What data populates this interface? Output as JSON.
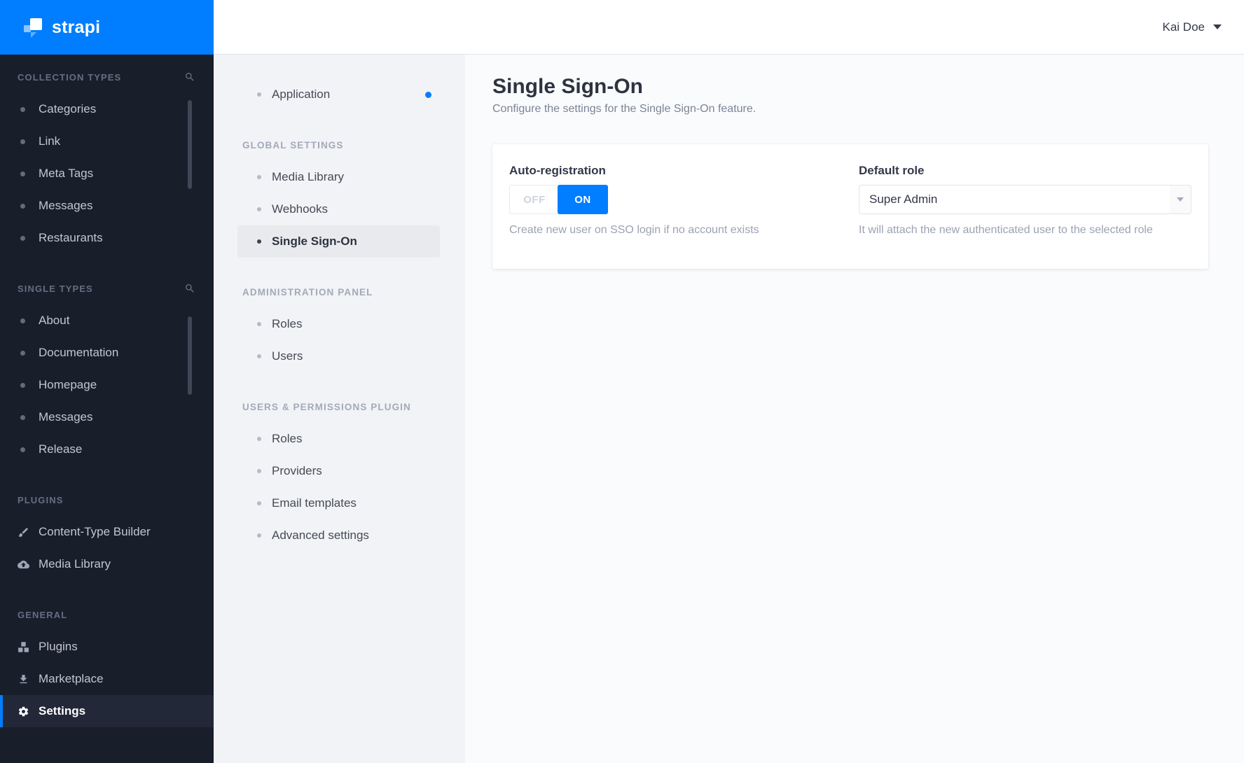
{
  "brand": {
    "name": "strapi"
  },
  "colors": {
    "accent_blue": "#007eff",
    "sidebar_bg": "#191e2b",
    "subnav_bg": "#f2f3f6",
    "toggle_on_bg": "#007eff"
  },
  "header": {
    "user_name": "Kai Doe"
  },
  "sidebar": {
    "sections": [
      {
        "label": "COLLECTION TYPES",
        "has_search": true,
        "items": [
          {
            "label": "Categories"
          },
          {
            "label": "Link"
          },
          {
            "label": "Meta Tags"
          },
          {
            "label": "Messages"
          },
          {
            "label": "Restaurants"
          }
        ]
      },
      {
        "label": "SINGLE TYPES",
        "has_search": true,
        "items": [
          {
            "label": "About"
          },
          {
            "label": "Documentation"
          },
          {
            "label": "Homepage"
          },
          {
            "label": "Messages"
          },
          {
            "label": "Release"
          }
        ]
      },
      {
        "label": "PLUGINS",
        "items": [
          {
            "label": "Content-Type Builder",
            "icon": "brush-icon"
          },
          {
            "label": "Media Library",
            "icon": "cloud-upload-icon"
          }
        ]
      },
      {
        "label": "GENERAL",
        "items": [
          {
            "label": "Plugins",
            "icon": "cubes-icon"
          },
          {
            "label": "Marketplace",
            "icon": "download-icon"
          },
          {
            "label": "Settings",
            "icon": "gear-icon",
            "active": true
          }
        ]
      }
    ]
  },
  "subnav": {
    "top_items": [
      {
        "label": "Application",
        "has_notification": true
      }
    ],
    "sections": [
      {
        "label": "GLOBAL SETTINGS",
        "items": [
          {
            "label": "Media Library"
          },
          {
            "label": "Webhooks"
          },
          {
            "label": "Single Sign-On",
            "active": true
          }
        ]
      },
      {
        "label": "ADMINISTRATION PANEL",
        "items": [
          {
            "label": "Roles"
          },
          {
            "label": "Users"
          }
        ]
      },
      {
        "label": "USERS & PERMISSIONS PLUGIN",
        "items": [
          {
            "label": "Roles"
          },
          {
            "label": "Providers"
          },
          {
            "label": "Email templates"
          },
          {
            "label": "Advanced settings"
          }
        ]
      }
    ]
  },
  "main": {
    "title": "Single Sign-On",
    "subtitle": "Configure the settings for the Single Sign-On feature.",
    "card": {
      "auto_registration": {
        "label": "Auto-registration",
        "off_label": "OFF",
        "on_label": "ON",
        "selected": "ON",
        "helper": "Create new user on SSO login if no account exists"
      },
      "default_role": {
        "label": "Default role",
        "value": "Super Admin",
        "helper": "It will attach the new authenticated user to the selected role"
      }
    }
  }
}
